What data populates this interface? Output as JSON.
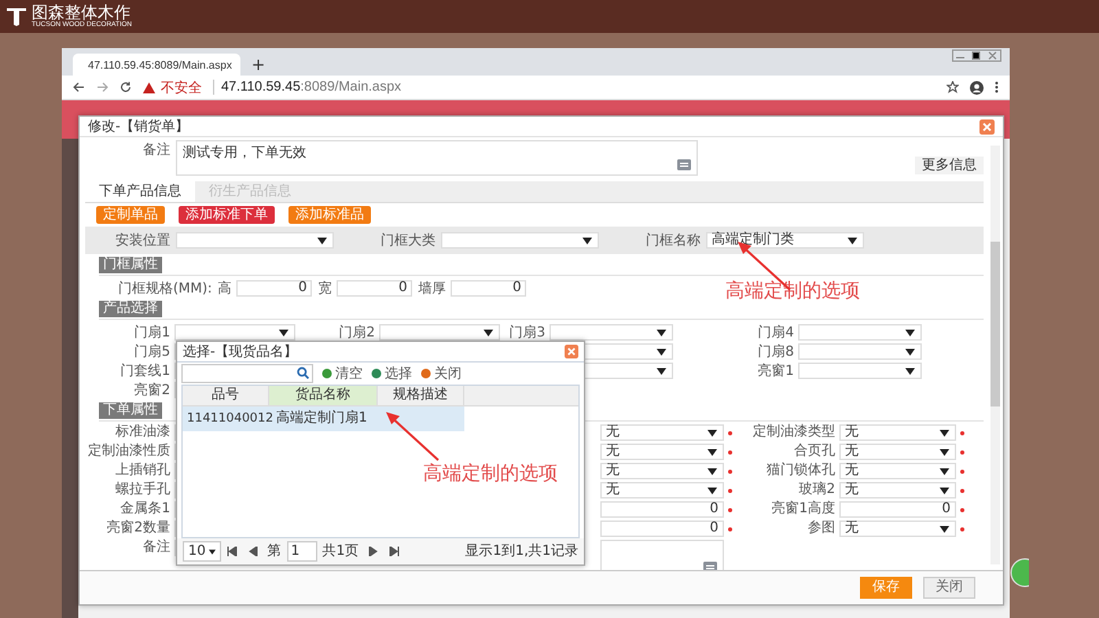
{
  "brand": {
    "name": "图森整体木作",
    "tagline": "TUCSON WOOD DECORATION"
  },
  "browser": {
    "tab_title": "47.110.59.45:8089/Main.aspx",
    "new_tab": "+",
    "security": "不安全",
    "url_host": "47.110.59.45",
    "url_rest": ":8089/Main.aspx"
  },
  "modal": {
    "title": "修改-【销货单】",
    "remark_label": "备注",
    "remark_value": "测试专用，下单无效",
    "more_button": "更多信息",
    "tabs": [
      {
        "label": "下单产品信息",
        "selected": true
      },
      {
        "label": "衍生产品信息",
        "selected": false
      }
    ],
    "actions": [
      {
        "label": "定制单品",
        "kind": "orange"
      },
      {
        "label": "添加标准下单",
        "kind": "red"
      },
      {
        "label": "添加标准品",
        "kind": "orange"
      }
    ],
    "category_row": [
      {
        "label": "安装位置"
      },
      {
        "label": "门框大类"
      },
      {
        "label": "门框名称",
        "value": "高端定制门类"
      }
    ],
    "frame_section": {
      "title": "门框属性",
      "spec_label": "门框规格(MM):",
      "dims": [
        {
          "label": "高",
          "value": "0"
        },
        {
          "label": "宽",
          "value": "0"
        },
        {
          "label": "墙厚",
          "value": "0"
        }
      ]
    },
    "product_section": {
      "title": "产品选择",
      "rows": [
        [
          {
            "label": "门扇1"
          },
          {
            "label": "门扇2"
          },
          {
            "label": "门扇3"
          },
          {
            "label": "门扇4"
          }
        ],
        [
          {
            "label": "门扇5"
          },
          {},
          {},
          {
            "label": "门扇8"
          }
        ],
        [
          {
            "label": "门套线1"
          },
          {},
          {},
          {
            "label": "亮窗1"
          }
        ],
        [
          {
            "label": "亮窗2"
          }
        ]
      ]
    },
    "order_section": {
      "title": "下单属性",
      "rows": [
        {
          "label": "标准油漆",
          "middle": {
            "kind": "select",
            "value": "无",
            "required": true
          },
          "right": {
            "label": "定制油漆类型",
            "kind": "select",
            "value": "无",
            "required": true
          }
        },
        {
          "label": "定制油漆性质",
          "middle": {
            "kind": "select",
            "value": "无",
            "required": true
          },
          "right": {
            "label": "合页孔",
            "kind": "select",
            "value": "无",
            "required": true
          }
        },
        {
          "label": "上插销孔",
          "middle": {
            "kind": "select",
            "value": "无",
            "required": true
          },
          "right": {
            "label": "猫门锁体孔",
            "kind": "select",
            "value": "无",
            "required": true
          }
        },
        {
          "label": "螺拉手孔",
          "middle": {
            "kind": "select",
            "value": "无",
            "required": true
          },
          "right": {
            "label": "玻璃2",
            "kind": "select",
            "value": "无",
            "required": true
          }
        },
        {
          "label": "金属条1",
          "middle": {
            "kind": "number",
            "value": "0",
            "required": true
          },
          "right": {
            "label": "亮窗1高度",
            "kind": "number",
            "value": "0",
            "required": true
          }
        },
        {
          "label": "亮窗2数量",
          "middle": {
            "kind": "number",
            "value": "0",
            "required": true
          },
          "right": {
            "label": "参图",
            "kind": "select",
            "value": "无",
            "required": true
          }
        },
        {
          "label": "备注",
          "middle": {
            "kind": "textarea"
          }
        }
      ]
    },
    "footer": [
      {
        "label": "保存",
        "kind": "primary"
      },
      {
        "label": "关闭",
        "kind": "default"
      }
    ]
  },
  "picker": {
    "title": "选择-【现货品名】",
    "tools": [
      {
        "label": "清空",
        "kind": "clear"
      },
      {
        "label": "选择",
        "kind": "select"
      },
      {
        "label": "关闭",
        "kind": "close"
      }
    ],
    "columns": [
      {
        "label": "品号",
        "highlighted": false
      },
      {
        "label": "货品名称",
        "highlighted": true
      },
      {
        "label": "规格描述",
        "highlighted": false
      }
    ],
    "rows": [
      {
        "cells": [
          "11411040012",
          "高端定制门扇1"
        ],
        "selected": true
      }
    ],
    "pager": {
      "page_size": "10",
      "page_prefix": "第",
      "page": "1",
      "page_total": "共1页",
      "summary": "显示1到1,共1记录"
    }
  },
  "annotations": [
    {
      "text": "高端定制的选项"
    },
    {
      "text": "高端定制的选项"
    }
  ]
}
